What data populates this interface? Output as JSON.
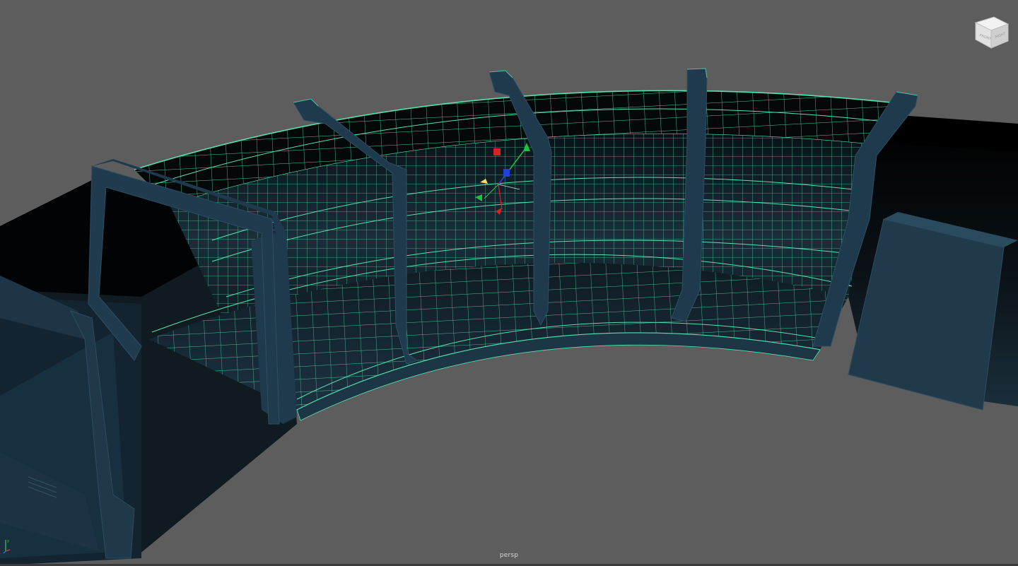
{
  "viewport": {
    "camera_name": "persp",
    "background_color": "#5d5d5d"
  },
  "viewcube": {
    "icon": "view-cube-icon"
  },
  "axis_indicator": {
    "icon": "xyz-axis-icon",
    "colors": {
      "x": "#d23c3c",
      "y": "#4cc44c",
      "z": "#4c6ee0"
    }
  },
  "manipulator": {
    "icon": "move-manipulator-icon",
    "colors": {
      "x": "#e02020",
      "y": "#20c040",
      "z": "#2040e0",
      "center": "#f0e060"
    }
  },
  "model": {
    "wireframe_color": "#58e0b0",
    "surface_dark": "#060a0d",
    "surface_teal": "#1f3a4c"
  }
}
